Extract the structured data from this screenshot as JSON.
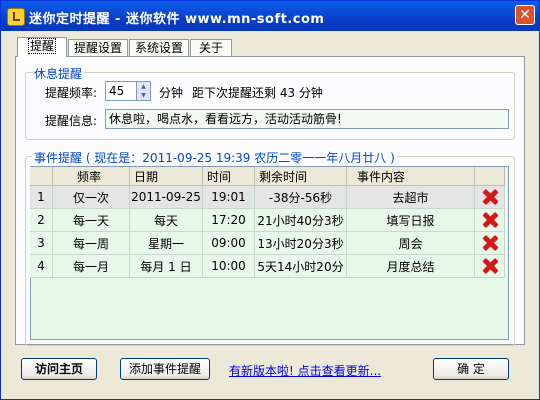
{
  "window": {
    "title": "迷你定时提醒 - 迷你软件 www.mn-soft.com",
    "close_glyph": "✕"
  },
  "tabs": [
    {
      "label": "提醒"
    },
    {
      "label": "提醒设置"
    },
    {
      "label": "系统设置"
    },
    {
      "label": "关于"
    }
  ],
  "rest_reminder": {
    "group_label": "休息提醒",
    "frequency_label": "提醒频率:",
    "frequency_value": "45",
    "frequency_unit": "分钟",
    "next_text": "距下次提醒还剩 43 分钟",
    "message_label": "提醒信息:",
    "message_value": "休息啦，喝点水，看看远方，活动活动筋骨!"
  },
  "event_reminder": {
    "group_label": "事件提醒 ( 现在是：2011-09-25 19:39 农历二零一一年八月廿八 )",
    "columns": [
      "",
      "频率",
      "日期",
      "时间",
      "剩余时间",
      "事件内容",
      ""
    ],
    "rows": [
      {
        "idx": "1",
        "freq": "仅一次",
        "date": "2011-09-25",
        "time": "19:01",
        "remain": "-38分-56秒",
        "content": "去超市"
      },
      {
        "idx": "2",
        "freq": "每一天",
        "date": "每天",
        "time": "17:20",
        "remain": "21小时40分3秒",
        "content": "填写日报"
      },
      {
        "idx": "3",
        "freq": "每一周",
        "date": "星期一",
        "time": "09:00",
        "remain": "13小时20分3秒",
        "content": "周会"
      },
      {
        "idx": "4",
        "freq": "每一月",
        "date": "每月 1 日",
        "time": "10:00",
        "remain": "5天14小时20分",
        "content": "月度总结"
      }
    ]
  },
  "footer": {
    "home_button": "访问主页",
    "add_event_button": "添加事件提醒",
    "update_link": "有新版本啦! 点击查看更新...",
    "ok_button": "确 定"
  },
  "colors": {
    "title_bar": "#0A4FDA",
    "group_label": "#0046D5",
    "input_bg": "#F0FAF0",
    "grid_bg": "#E8F8E8",
    "delete": "#D41818"
  }
}
